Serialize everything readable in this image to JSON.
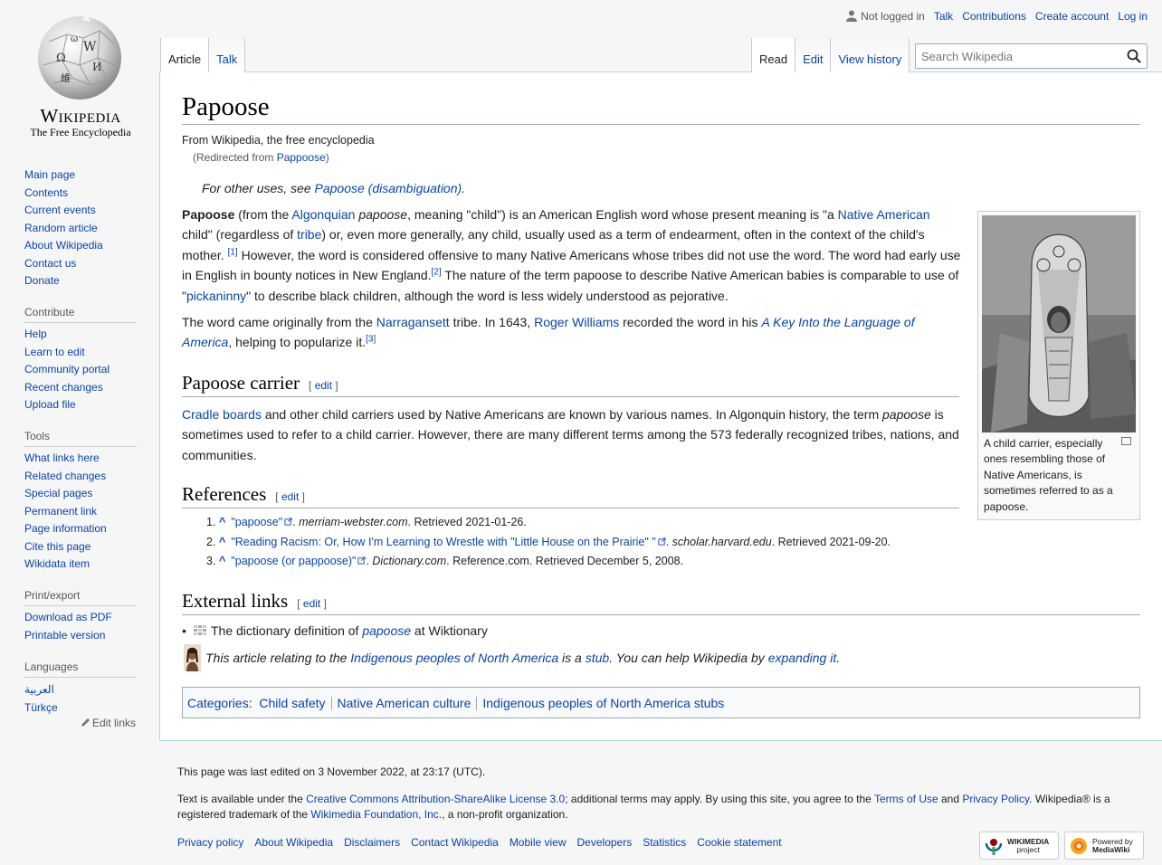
{
  "logo": {
    "wordmark": "Wikipedia",
    "tagline": "The Free Encyclopedia"
  },
  "personal": {
    "status": "Not logged in",
    "links": [
      "Talk",
      "Contributions",
      "Create account",
      "Log in"
    ]
  },
  "tabs": {
    "left": [
      "Article",
      "Talk"
    ],
    "right": [
      "Read",
      "Edit",
      "View history"
    ]
  },
  "search": {
    "placeholder": "Search Wikipedia"
  },
  "sidebar": {
    "navigation": [
      "Main page",
      "Contents",
      "Current events",
      "Random article",
      "About Wikipedia",
      "Contact us",
      "Donate"
    ],
    "contribute": {
      "heading": "Contribute",
      "items": [
        "Help",
        "Learn to edit",
        "Community portal",
        "Recent changes",
        "Upload file"
      ]
    },
    "tools": {
      "heading": "Tools",
      "items": [
        "What links here",
        "Related changes",
        "Special pages",
        "Permanent link",
        "Page information",
        "Cite this page",
        "Wikidata item"
      ]
    },
    "print": {
      "heading": "Print/export",
      "items": [
        "Download as PDF",
        "Printable version"
      ]
    },
    "languages": {
      "heading": "Languages",
      "items": [
        "العربية",
        "Türkçe"
      ],
      "edit_links": "Edit links"
    }
  },
  "article": {
    "title": "Papoose",
    "tagline": "From Wikipedia, the free encyclopedia",
    "redirect_prefix": "(Redirected from ",
    "redirect_link": "Pappoose",
    "redirect_suffix": ")",
    "hatnote_prefix": "For other uses, see ",
    "hatnote_link": "Papoose (disambiguation)",
    "hatnote_suffix": ".",
    "p1": {
      "bold": "Papoose",
      "t1": " (from the ",
      "l1": "Algonquian",
      "t2": " ",
      "i1": "papoose",
      "t3": ", meaning \"child\") is an American English word whose present meaning is \"a ",
      "l2": "Native American",
      "t4": " child\" (regardless of ",
      "l3": "tribe",
      "t5": ") or, even more generally, any child, usually used as a term of endearment, often in the context of the child's mother.",
      "r1": "[1]",
      "t6": " However, the word is considered offensive to many Native Americans whose tribes did not use the word. The word had early use in English in bounty notices in New England.",
      "r2": "[2]",
      "t7": " The nature of the term papoose to describe Native American babies is comparable to use of \"",
      "l4": "pickaninny",
      "t8": "\" to describe black children, although the word is less widely understood as pejorative."
    },
    "p2": {
      "t1": "The word came originally from the ",
      "l1": "Narragansett",
      "t2": " tribe. In 1643, ",
      "l2": "Roger Williams",
      "t3": " recorded the word in his ",
      "l3": "A Key Into the Language of America",
      "t4": ", helping to popularize it.",
      "r3": "[3]"
    },
    "h_carrier": "Papoose carrier",
    "p3": {
      "l1": "Cradle boards",
      "t1": " and other child carriers used by Native Americans are known by various names. In Algonquin history, the term ",
      "i1": "papoose",
      "t2": " is sometimes used to refer to a child carrier. However, there are many different terms among the 573 federally recognized tribes, nations, and communities."
    },
    "h_refs": "References",
    "refs": [
      {
        "num": "1.",
        "link": "\"papoose\"",
        "pub": "merriam-webster.com",
        "rest": ". Retrieved 2021-01-26."
      },
      {
        "num": "2.",
        "link": "\"Reading Racism: Or, How I'm Learning to Wrestle with \"Little House on the Prairie\" \"",
        "pub": "scholar.harvard.edu",
        "rest": ". Retrieved 2021-09-20."
      },
      {
        "num": "3.",
        "link": "\"papoose (or pappoose)\"",
        "pub": "Dictionary.com",
        "rest": ". Reference.com. Retrieved December 5, 2008."
      }
    ],
    "h_ext": "External links",
    "ext": {
      "t1": "The dictionary definition of ",
      "l1": "papoose",
      "t2": " at Wiktionary"
    },
    "stub": {
      "t1": "This article relating to the ",
      "l1": "Indigenous peoples of North America",
      "t2": " is a ",
      "l2": "stub",
      "t3": ". You can help Wikipedia by ",
      "l3": "expanding it",
      "t4": "."
    },
    "edit_label": "edit",
    "caption": "A child carrier, especially ones resembling those of Native Americans, is sometimes referred to as a papoose."
  },
  "categories": {
    "label": "Categories",
    "items": [
      "Child safety",
      "Native American culture",
      "Indigenous peoples of North America stubs"
    ]
  },
  "footer": {
    "last_edited": "This page was last edited on 3 November 2022, at 23:17 (UTC).",
    "lic": {
      "t1": "Text is available under the ",
      "l1": "Creative Commons Attribution-ShareAlike License 3.0",
      "t2": "; additional terms may apply. By using this site, you agree to the ",
      "l2": "Terms of Use",
      "t3": " and ",
      "l3": "Privacy Policy",
      "t4": ". Wikipedia® is a registered trademark of the ",
      "l4": "Wikimedia Foundation, Inc.",
      "t5": ", a non-profit organization."
    },
    "links": [
      "Privacy policy",
      "About Wikipedia",
      "Disclaimers",
      "Contact Wikipedia",
      "Mobile view",
      "Developers",
      "Statistics",
      "Cookie statement"
    ],
    "badge1": {
      "l1": "WIKIMEDIA",
      "l2": "project"
    },
    "badge2": {
      "l1": "Powered by",
      "l2": "MediaWiki"
    }
  }
}
